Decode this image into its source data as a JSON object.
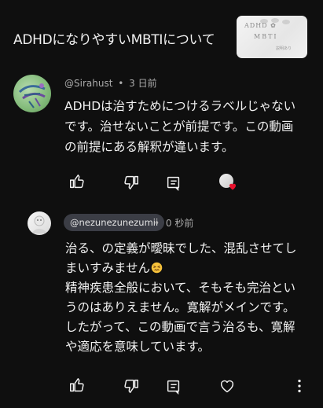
{
  "video": {
    "title": "ADHDになりやすいMBTIについて",
    "thumbnail": {
      "line1": "ADHD ✿",
      "line2": "MBTI",
      "line3": "説明あり"
    }
  },
  "comment": {
    "author": "@Sirahust",
    "separator": "•",
    "time": "3 日前",
    "lines": [
      "ADHDは治すためにつけるラベルじゃない",
      "です。治せないことが前提です。この動画",
      "の前提にある解釈が違います。"
    ],
    "actions": [
      "like-icon",
      "dislike-icon",
      "reply-icon"
    ],
    "creator_heart": true
  },
  "reply": {
    "author": "@nezunezunezumii",
    "separator": "•",
    "time": "0 秒前",
    "lines": [
      "治る、の定義が曖昧でした、混乱させてし",
      "まいすみません",
      "精神疾患全般において、そもそも完治とい",
      "うのはありえません。寛解がメインです。",
      "したがって、この動画で言う治るも、寛解",
      "や適応を意味しています。"
    ],
    "emoji": "persevering-face",
    "actions": [
      "like-icon",
      "dislike-icon",
      "reply-icon",
      "heart-icon",
      "more-icon"
    ]
  },
  "colors": {
    "background": "#0f0f0f",
    "text": "#f1f1f1",
    "secondary_text": "#aaaaaa",
    "chip": "#3b3d45",
    "heart": "#e8112d"
  }
}
